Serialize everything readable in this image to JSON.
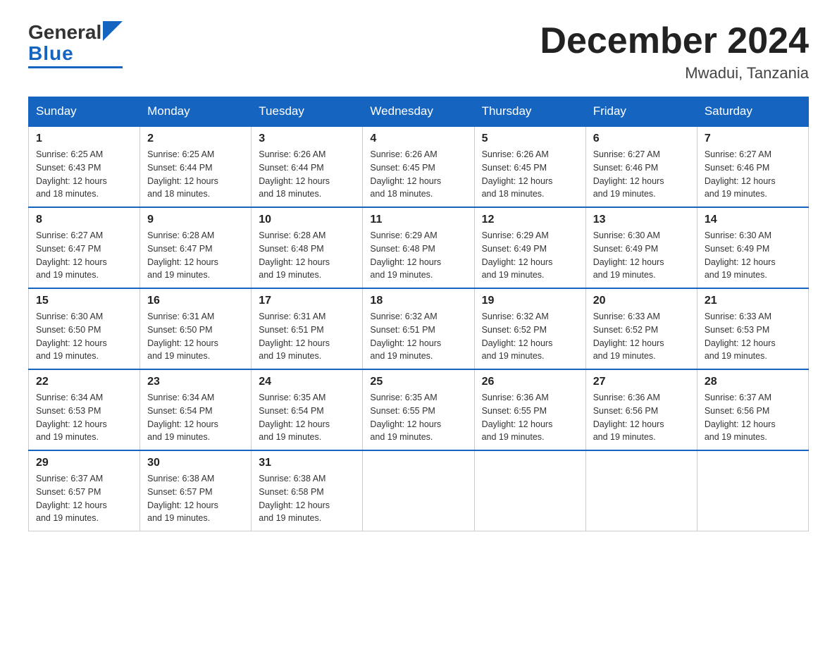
{
  "logo": {
    "general": "General",
    "blue": "Blue"
  },
  "title": {
    "month_year": "December 2024",
    "location": "Mwadui, Tanzania"
  },
  "headers": [
    "Sunday",
    "Monday",
    "Tuesday",
    "Wednesday",
    "Thursday",
    "Friday",
    "Saturday"
  ],
  "weeks": [
    [
      {
        "day": "1",
        "sunrise": "6:25 AM",
        "sunset": "6:43 PM",
        "daylight": "12 hours and 18 minutes."
      },
      {
        "day": "2",
        "sunrise": "6:25 AM",
        "sunset": "6:44 PM",
        "daylight": "12 hours and 18 minutes."
      },
      {
        "day": "3",
        "sunrise": "6:26 AM",
        "sunset": "6:44 PM",
        "daylight": "12 hours and 18 minutes."
      },
      {
        "day": "4",
        "sunrise": "6:26 AM",
        "sunset": "6:45 PM",
        "daylight": "12 hours and 18 minutes."
      },
      {
        "day": "5",
        "sunrise": "6:26 AM",
        "sunset": "6:45 PM",
        "daylight": "12 hours and 18 minutes."
      },
      {
        "day": "6",
        "sunrise": "6:27 AM",
        "sunset": "6:46 PM",
        "daylight": "12 hours and 19 minutes."
      },
      {
        "day": "7",
        "sunrise": "6:27 AM",
        "sunset": "6:46 PM",
        "daylight": "12 hours and 19 minutes."
      }
    ],
    [
      {
        "day": "8",
        "sunrise": "6:27 AM",
        "sunset": "6:47 PM",
        "daylight": "12 hours and 19 minutes."
      },
      {
        "day": "9",
        "sunrise": "6:28 AM",
        "sunset": "6:47 PM",
        "daylight": "12 hours and 19 minutes."
      },
      {
        "day": "10",
        "sunrise": "6:28 AM",
        "sunset": "6:48 PM",
        "daylight": "12 hours and 19 minutes."
      },
      {
        "day": "11",
        "sunrise": "6:29 AM",
        "sunset": "6:48 PM",
        "daylight": "12 hours and 19 minutes."
      },
      {
        "day": "12",
        "sunrise": "6:29 AM",
        "sunset": "6:49 PM",
        "daylight": "12 hours and 19 minutes."
      },
      {
        "day": "13",
        "sunrise": "6:30 AM",
        "sunset": "6:49 PM",
        "daylight": "12 hours and 19 minutes."
      },
      {
        "day": "14",
        "sunrise": "6:30 AM",
        "sunset": "6:49 PM",
        "daylight": "12 hours and 19 minutes."
      }
    ],
    [
      {
        "day": "15",
        "sunrise": "6:30 AM",
        "sunset": "6:50 PM",
        "daylight": "12 hours and 19 minutes."
      },
      {
        "day": "16",
        "sunrise": "6:31 AM",
        "sunset": "6:50 PM",
        "daylight": "12 hours and 19 minutes."
      },
      {
        "day": "17",
        "sunrise": "6:31 AM",
        "sunset": "6:51 PM",
        "daylight": "12 hours and 19 minutes."
      },
      {
        "day": "18",
        "sunrise": "6:32 AM",
        "sunset": "6:51 PM",
        "daylight": "12 hours and 19 minutes."
      },
      {
        "day": "19",
        "sunrise": "6:32 AM",
        "sunset": "6:52 PM",
        "daylight": "12 hours and 19 minutes."
      },
      {
        "day": "20",
        "sunrise": "6:33 AM",
        "sunset": "6:52 PM",
        "daylight": "12 hours and 19 minutes."
      },
      {
        "day": "21",
        "sunrise": "6:33 AM",
        "sunset": "6:53 PM",
        "daylight": "12 hours and 19 minutes."
      }
    ],
    [
      {
        "day": "22",
        "sunrise": "6:34 AM",
        "sunset": "6:53 PM",
        "daylight": "12 hours and 19 minutes."
      },
      {
        "day": "23",
        "sunrise": "6:34 AM",
        "sunset": "6:54 PM",
        "daylight": "12 hours and 19 minutes."
      },
      {
        "day": "24",
        "sunrise": "6:35 AM",
        "sunset": "6:54 PM",
        "daylight": "12 hours and 19 minutes."
      },
      {
        "day": "25",
        "sunrise": "6:35 AM",
        "sunset": "6:55 PM",
        "daylight": "12 hours and 19 minutes."
      },
      {
        "day": "26",
        "sunrise": "6:36 AM",
        "sunset": "6:55 PM",
        "daylight": "12 hours and 19 minutes."
      },
      {
        "day": "27",
        "sunrise": "6:36 AM",
        "sunset": "6:56 PM",
        "daylight": "12 hours and 19 minutes."
      },
      {
        "day": "28",
        "sunrise": "6:37 AM",
        "sunset": "6:56 PM",
        "daylight": "12 hours and 19 minutes."
      }
    ],
    [
      {
        "day": "29",
        "sunrise": "6:37 AM",
        "sunset": "6:57 PM",
        "daylight": "12 hours and 19 minutes."
      },
      {
        "day": "30",
        "sunrise": "6:38 AM",
        "sunset": "6:57 PM",
        "daylight": "12 hours and 19 minutes."
      },
      {
        "day": "31",
        "sunrise": "6:38 AM",
        "sunset": "6:58 PM",
        "daylight": "12 hours and 19 minutes."
      },
      null,
      null,
      null,
      null
    ]
  ],
  "labels": {
    "sunrise": "Sunrise:",
    "sunset": "Sunset:",
    "daylight": "Daylight:"
  }
}
